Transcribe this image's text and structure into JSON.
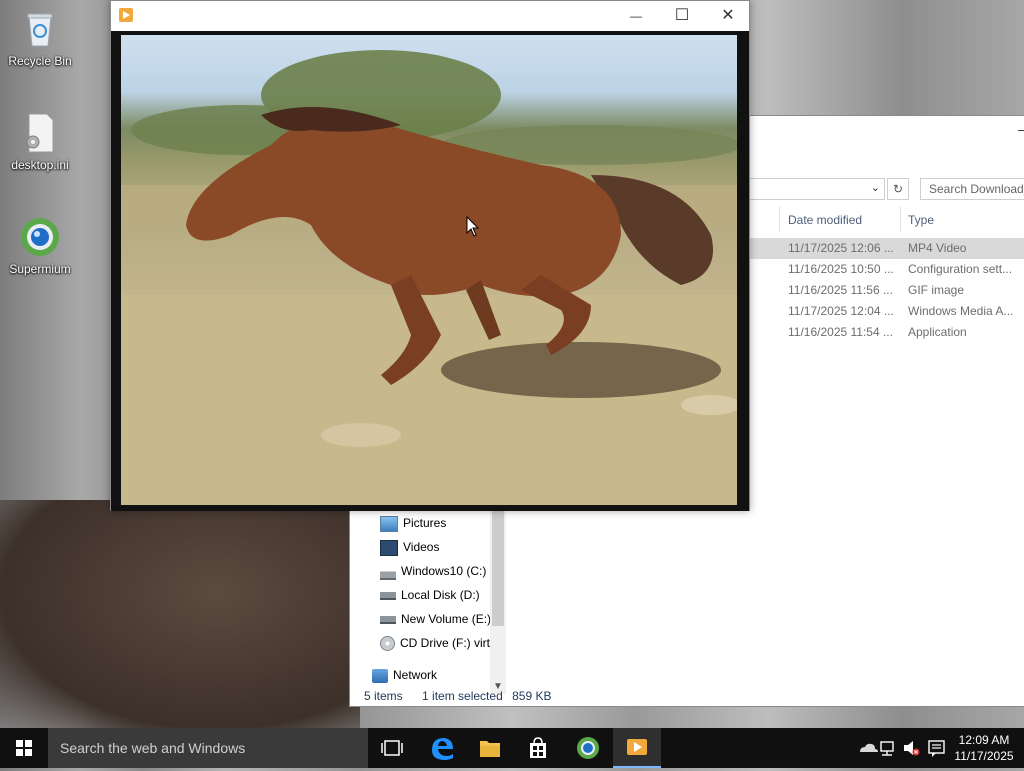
{
  "desktop": {
    "icons": [
      {
        "label": "Recycle Bin",
        "icon": "recycle-bin-icon"
      },
      {
        "label": "desktop.ini",
        "icon": "settings-file-icon"
      },
      {
        "label": "Supermium",
        "icon": "supermium-browser-icon"
      }
    ]
  },
  "explorer": {
    "search_placeholder": "Search Downloads",
    "columns": [
      "Date modified",
      "Type"
    ],
    "files": [
      {
        "date": "11/17/2025 12:06 ...",
        "type": "MP4 Video",
        "selected": true
      },
      {
        "date": "11/16/2025 10:50 ...",
        "type": "Configuration sett..."
      },
      {
        "date": "11/16/2025 11:56 ...",
        "type": "GIF image"
      },
      {
        "date": "11/17/2025 12:04 ...",
        "type": "Windows Media A..."
      },
      {
        "date": "11/16/2025 11:54 ...",
        "type": "Application"
      }
    ],
    "nav": [
      {
        "label": "Pictures",
        "icon": "pictures-folder-icon"
      },
      {
        "label": "Videos",
        "icon": "videos-folder-icon"
      },
      {
        "label": "Windows10 (C:)",
        "icon": "windows-drive-icon"
      },
      {
        "label": "Local Disk (D:)",
        "icon": "drive-icon"
      },
      {
        "label": "New Volume (E:)",
        "icon": "drive-icon"
      },
      {
        "label": "CD Drive (F:) virt",
        "icon": "cd-drive-icon"
      },
      {
        "label": "Network",
        "icon": "network-icon"
      }
    ],
    "status": {
      "count": "5 items",
      "selected": "1 item selected",
      "size": "859 KB"
    }
  },
  "player": {
    "title": "",
    "controls": {
      "minimize": "—",
      "maximize": "☐",
      "close": "✕"
    }
  },
  "taskbar": {
    "search_placeholder": "Search the web and Windows",
    "time": "12:09 AM",
    "date": "11/17/2025"
  }
}
